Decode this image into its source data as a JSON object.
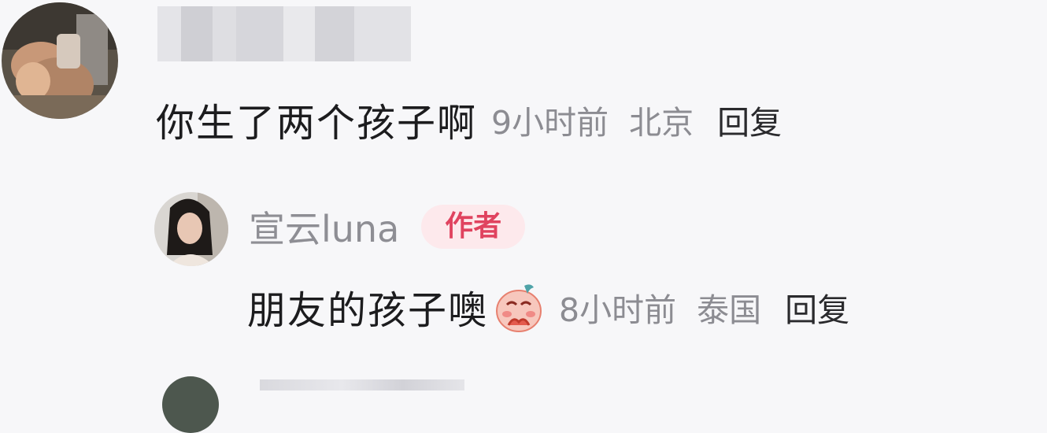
{
  "comment": {
    "avatar_icon": "user-avatar-photo",
    "username_blurred": true,
    "text": "你生了两个孩子啊",
    "time": "9小时前",
    "location": "北京",
    "reply_label": "回复"
  },
  "reply": {
    "avatar_icon": "user-avatar-photo",
    "username": "宣云luna",
    "badge": "作者",
    "text": "朋友的孩子噢",
    "emoji_icon": "shy-emoji-icon",
    "time": "8小时前",
    "location": "泰国",
    "reply_label": "回复"
  },
  "colors": {
    "background": "#f7f7f9",
    "badge_bg": "#fde9ec",
    "badge_text": "#e0435f",
    "meta_text": "#8c8c92"
  }
}
